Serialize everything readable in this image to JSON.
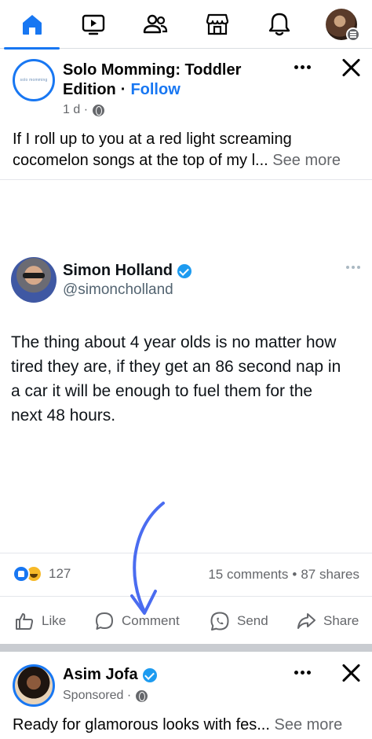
{
  "nav": {
    "tabs": [
      {
        "name": "home",
        "icon": "home-icon",
        "active": true
      },
      {
        "name": "video",
        "icon": "video-icon",
        "active": false
      },
      {
        "name": "friends",
        "icon": "friends-icon",
        "active": false
      },
      {
        "name": "marketplace",
        "icon": "marketplace-icon",
        "active": false
      },
      {
        "name": "notifications",
        "icon": "bell-icon",
        "active": false
      },
      {
        "name": "menu",
        "icon": "profile-menu-icon",
        "active": false
      }
    ],
    "accent": "#1877f2"
  },
  "post1": {
    "page_name_line1": "Solo Momming: Toddler",
    "page_name_line2": "Edition",
    "dot": "·",
    "follow_label": "Follow",
    "time": "1 d ·",
    "text_line1": "If I roll up to you at a red light screaming",
    "text_line2": "cocomelon songs at the top of my l...",
    "see_more": "See more"
  },
  "tweet": {
    "name": "Simon Holland",
    "handle": "@simoncholland",
    "text_line1": "The thing about 4 year olds is no matter how",
    "text_line2": "tired they are, if they get an 86 second nap in",
    "text_line3": "a car it will be enough to fuel them for the",
    "text_line4": "next 48 hours."
  },
  "post_stats": {
    "reaction_count": "127",
    "comments": "15 comments",
    "sep": "•",
    "shares": "87 shares"
  },
  "actions": {
    "like": "Like",
    "comment": "Comment",
    "send": "Send",
    "share": "Share"
  },
  "post2": {
    "name": "Asim Jofa",
    "sponsored": "Sponsored ·",
    "text": "Ready for glamorous looks with fes...",
    "see_more": "See more"
  }
}
